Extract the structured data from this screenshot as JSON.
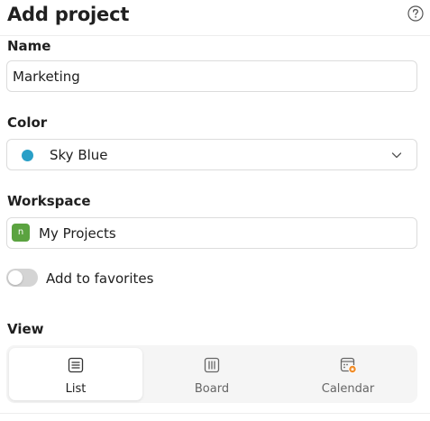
{
  "dialog": {
    "title": "Add project",
    "help_icon": "question-circle-icon"
  },
  "name_field": {
    "label": "Name",
    "value": "Marketing"
  },
  "color_field": {
    "label": "Color",
    "value": "Sky Blue",
    "swatch_color": "#299fc7",
    "dropdown_icon": "chevron-down-icon"
  },
  "workspace_field": {
    "label": "Workspace",
    "value": "My Projects",
    "badge_letter": "n",
    "badge_color": "#5ba340"
  },
  "favorites": {
    "label": "Add to favorites",
    "enabled": false
  },
  "view": {
    "label": "View",
    "options": [
      {
        "label": "List",
        "icon": "list-icon",
        "selected": true
      },
      {
        "label": "Board",
        "icon": "board-icon",
        "selected": false
      },
      {
        "label": "Calendar",
        "icon": "calendar-icon",
        "selected": false
      }
    ]
  }
}
